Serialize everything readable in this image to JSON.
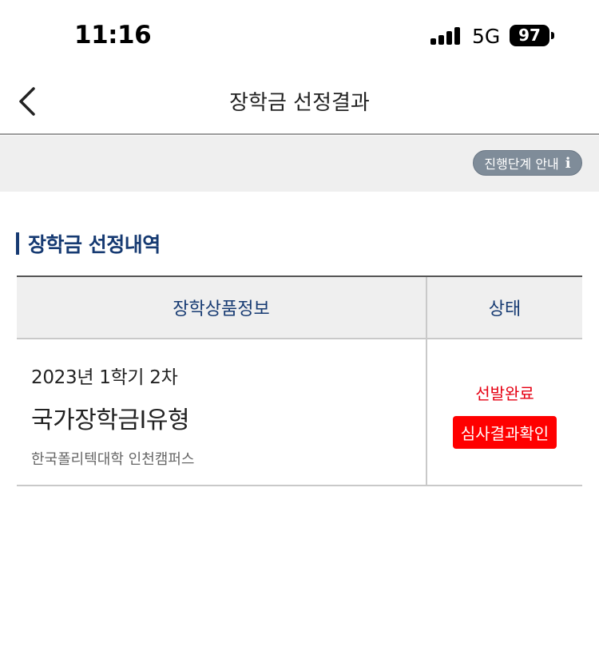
{
  "status_bar": {
    "time": "11:16",
    "network": "5G",
    "battery": "97"
  },
  "header": {
    "title": "장학금 선정결과"
  },
  "guide": {
    "label": "진행단계 안내",
    "icon": "info-icon"
  },
  "section": {
    "title": "장학금 선정내역"
  },
  "table": {
    "headers": [
      "장학상품정보",
      "상태"
    ],
    "rows": [
      {
        "semester": "2023년 1학기 2차",
        "name": "국가장학금I유형",
        "school": "한국폴리텍대학 인천캠퍼스",
        "status": "선발완료",
        "action": "심사결과확인"
      }
    ]
  },
  "colors": {
    "accent_navy": "#163a72",
    "status_red": "#e60012",
    "button_red": "#ff0000",
    "guide_button": "#7f8c99"
  }
}
